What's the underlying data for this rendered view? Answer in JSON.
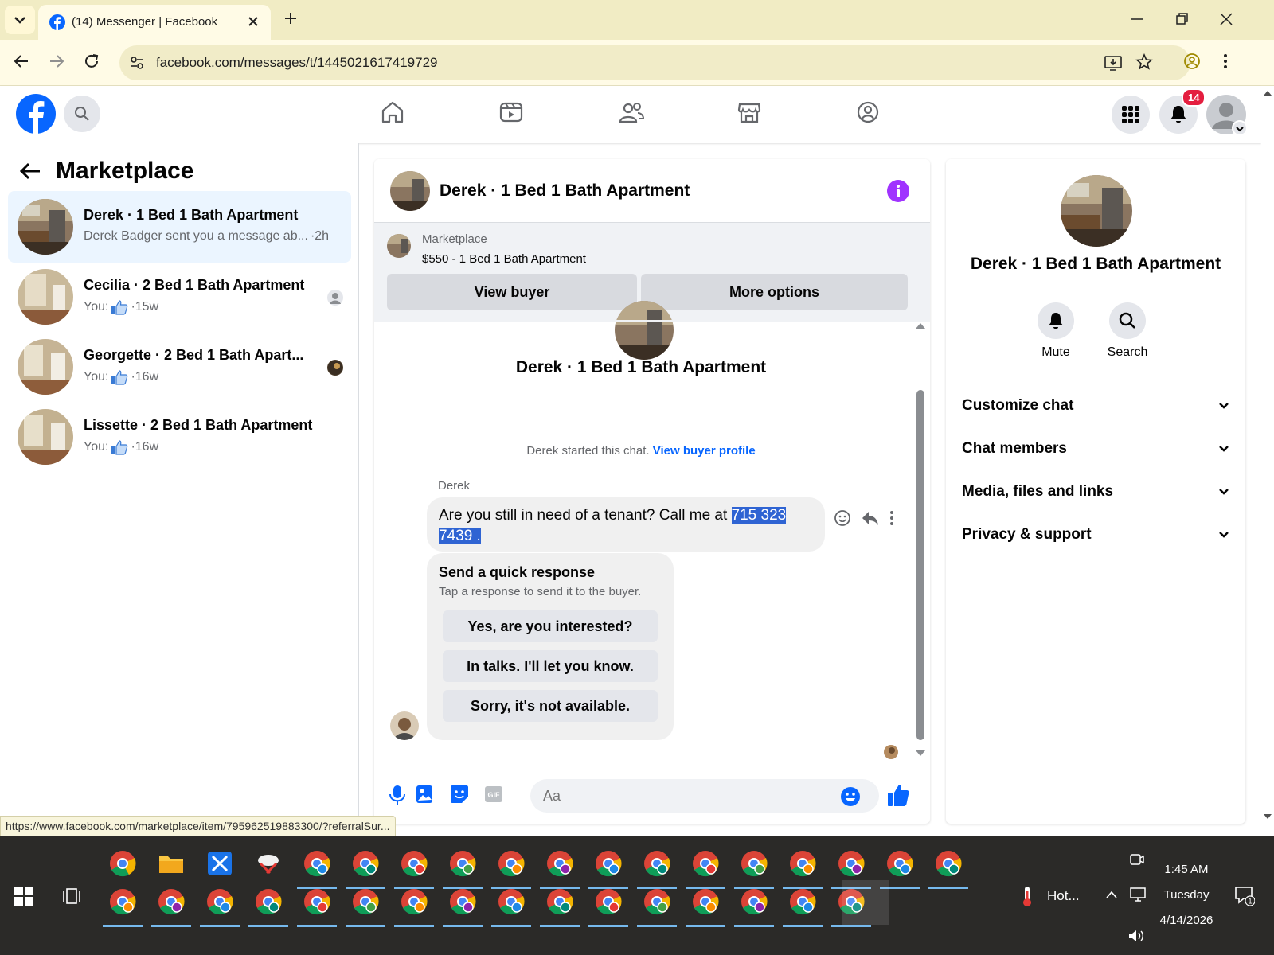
{
  "browser": {
    "tab_title": "(14) Messenger | Facebook",
    "url": "facebook.com/messages/t/1445021617419729",
    "status_link": "https://www.facebook.com/marketplace/item/795962519883300/?referralSur..."
  },
  "fb": {
    "notification_count": "14"
  },
  "left": {
    "title": "Marketplace",
    "conversations": [
      {
        "name": "Derek · 1 Bed 1 Bath Apartment",
        "preview": "Derek Badger sent you a message ab...",
        "time": "·2h"
      },
      {
        "name": "Cecilia · 2 Bed 1 Bath Apartment",
        "preview": "You:",
        "time": "·15w"
      },
      {
        "name": "Georgette · 2 Bed 1 Bath Apart...",
        "preview": "You:",
        "time": "·16w"
      },
      {
        "name": "Lissette · 2 Bed 1 Bath Apartment",
        "preview": "You:",
        "time": "·16w"
      }
    ]
  },
  "chat": {
    "title": "Derek · 1 Bed 1 Bath Apartment",
    "marketplace_label": "Marketplace",
    "listing": "$550 - 1 Bed 1 Bath Apartment",
    "view_buyer": "View buyer",
    "more_options": "More options",
    "header_name": "Derek · 1 Bed 1 Bath Apartment",
    "started_text": "Derek started this chat.",
    "view_buyer_profile": "View buyer profile",
    "sender": "Derek",
    "message_plain": "Are you still in need of a tenant? Call me at ",
    "message_selected_1": "715 323 ",
    "message_selected_2": "7439 .",
    "quick_title": "Send a quick response",
    "quick_sub": "Tap a response to send it to the buyer.",
    "quick_responses": [
      "Yes, are you interested?",
      "In talks. I'll let you know.",
      "Sorry, it's not available."
    ],
    "input_placeholder": "Aa"
  },
  "right": {
    "title": "Derek · 1 Bed 1 Bath Apartment",
    "mute": "Mute",
    "search": "Search",
    "sections": [
      "Customize chat",
      "Chat members",
      "Media, files and links",
      "Privacy & support"
    ]
  },
  "taskbar": {
    "weather": "Hot...",
    "time": "1:45 AM",
    "day": "Tuesday",
    "date": "4/14/2026"
  },
  "colors": {
    "fb_blue": "#0866ff",
    "selection": "#2f64d3",
    "active_conv": "#ebf5ff",
    "info_purple": "#a033ff"
  }
}
